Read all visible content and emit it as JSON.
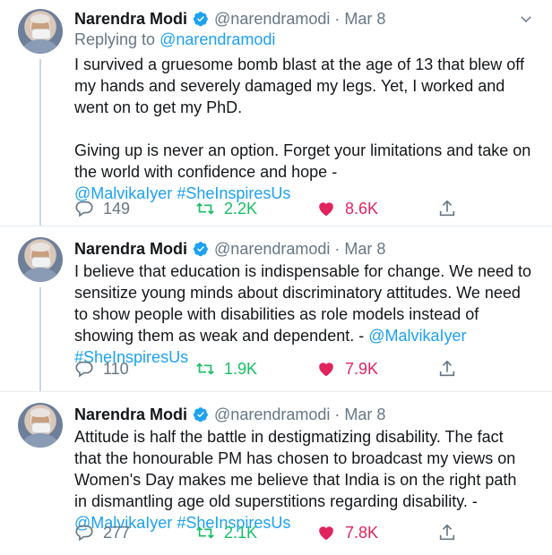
{
  "tweets": [
    {
      "name": "Narendra Modi",
      "handle": "@narendramodi",
      "dot": "·",
      "date": "Mar 8",
      "reply_prefix": "Replying to",
      "reply_handle": "@narendramodi",
      "paragraph1": "I survived a gruesome bomb blast at the age of 13 that blew off my hands and severely damaged my legs. Yet, I worked and went on to get my PhD.",
      "paragraph2_text": "Giving up is never an option. Forget your limitations and take on the world with confidence and hope - ",
      "mention": "@MalvikaIyer",
      "hashtag": "#SheInspiresUs",
      "replies": "149",
      "retweets": "2.2K",
      "likes": "8.6K"
    },
    {
      "name": "Narendra Modi",
      "handle": "@narendramodi",
      "dot": "·",
      "date": "Mar 8",
      "text": "I believe that education is indispensable for change. We need to sensitize young minds about discriminatory attitudes. We need to show people with disabilities as role models instead of showing them as weak and dependent. - ",
      "mention": "@MalvikaIyer",
      "hashtag": "#SheInspiresUs",
      "replies": "110",
      "retweets": "1.9K",
      "likes": "7.9K"
    },
    {
      "name": "Narendra Modi",
      "handle": "@narendramodi",
      "dot": "·",
      "date": "Mar 8",
      "text": "Attitude is half the battle in destigmatizing disability. The fact that the honourable PM has chosen to broadcast my views on Women's Day makes me believe that India is on the right path in dismantling age old superstitions regarding disability. - ",
      "mention": "@MalvikaIyer",
      "hashtag": "#SheInspiresUs",
      "replies": "277",
      "retweets": "2.1K",
      "likes": "7.8K"
    }
  ],
  "colors": {
    "link": "#1da1f2",
    "retweet": "#17bf63",
    "like": "#e0245e",
    "muted": "#657786"
  },
  "icons": [
    "verified-badge-icon",
    "chevron-down-icon",
    "reply-icon",
    "retweet-icon",
    "heart-icon",
    "share-icon"
  ]
}
